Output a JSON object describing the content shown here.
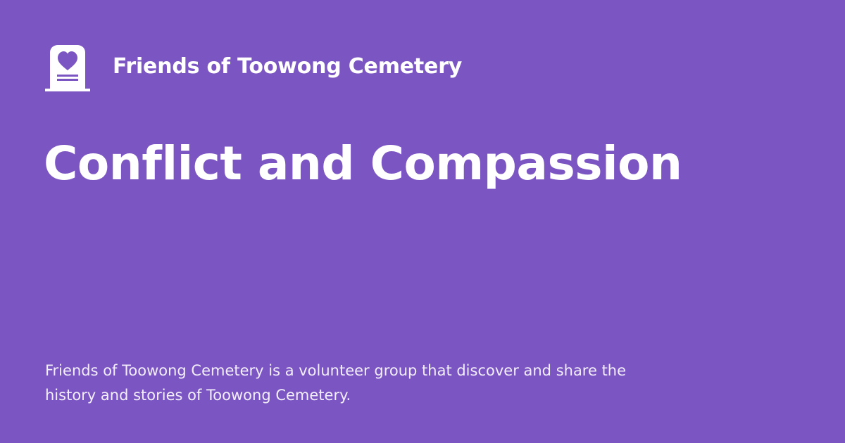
{
  "brand": {
    "name": "Friends of Toowong Cemetery",
    "logo_icon": "heart-headstone-icon"
  },
  "page": {
    "title": "Conflict and Compassion",
    "description": "Friends of Toowong Cemetery is a volunteer group that discover and share the history and stories of Toowong Cemetery."
  },
  "colors": {
    "background": "#7b55c1",
    "text": "#ffffff",
    "muted_text": "#f3eefc"
  }
}
